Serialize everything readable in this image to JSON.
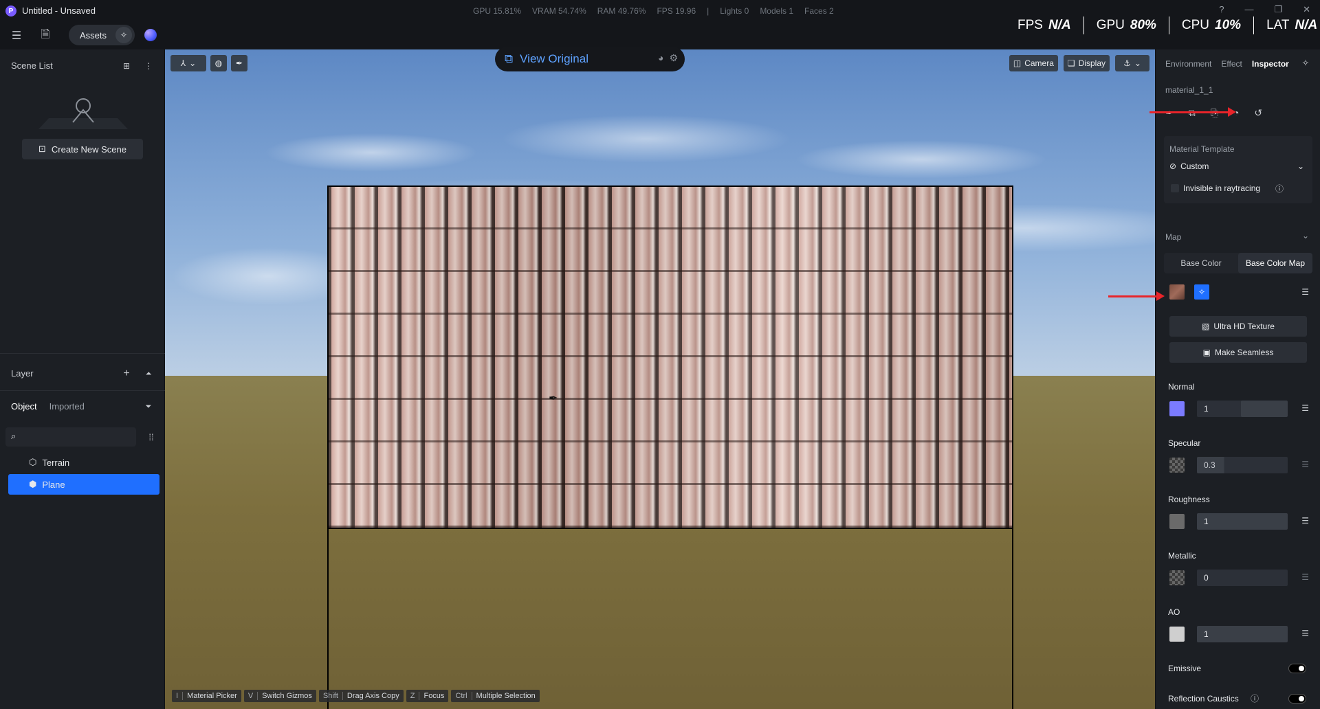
{
  "titlebar": {
    "app_title": "Untitled - Unsaved",
    "stats": [
      "GPU 15.81%",
      "VRAM 54.74%",
      "RAM 49.76%",
      "FPS 19.96",
      "|",
      "Lights 0",
      "Models 1",
      "Faces 2"
    ]
  },
  "perf": {
    "fps_label": "FPS",
    "fps_val": "N/A",
    "gpu_label": "GPU",
    "gpu_val": "80%",
    "cpu_label": "CPU",
    "cpu_val": "10%",
    "lat_label": "LAT",
    "lat_val": "N/A"
  },
  "toolbar": {
    "assets_label": "Assets"
  },
  "left": {
    "scene_list": "Scene List",
    "create_scene": "Create New Scene",
    "layer": "Layer",
    "tab_object": "Object",
    "tab_imported": "Imported",
    "tree": [
      {
        "label": "Terrain"
      },
      {
        "label": "Plane"
      }
    ]
  },
  "viewport": {
    "view_original": "View Original",
    "camera": "Camera",
    "display": "Display",
    "shortcuts": [
      {
        "key": "I",
        "label": "Material Picker"
      },
      {
        "key": "V",
        "label": "Switch Gizmos"
      },
      {
        "key": "Shift",
        "label": "Drag Axis Copy"
      },
      {
        "key": "Z",
        "label": "Focus"
      },
      {
        "key": "Ctrl",
        "label": "Multiple Selection"
      }
    ]
  },
  "inspector": {
    "tabs": [
      "Environment",
      "Effect",
      "Inspector"
    ],
    "material_name": "material_1_1",
    "material_template": "Material Template",
    "template_value": "Custom",
    "invisible_rt": "Invisible in raytracing",
    "map": "Map",
    "base_color": "Base Color",
    "base_color_map": "Base Color Map",
    "ultra_hd": "Ultra HD Texture",
    "make_seamless": "Make Seamless",
    "normal": "Normal",
    "normal_val": "1",
    "specular": "Specular",
    "specular_val": "0.3",
    "roughness": "Roughness",
    "roughness_val": "1",
    "metallic": "Metallic",
    "metallic_val": "0",
    "ao": "AO",
    "ao_val": "1",
    "emissive": "Emissive",
    "reflection_caustics": "Reflection Caustics"
  },
  "colors": {
    "accent": "#1f6fff",
    "normal_swatch": "#7b7bff",
    "annotation": "#e8242a"
  }
}
